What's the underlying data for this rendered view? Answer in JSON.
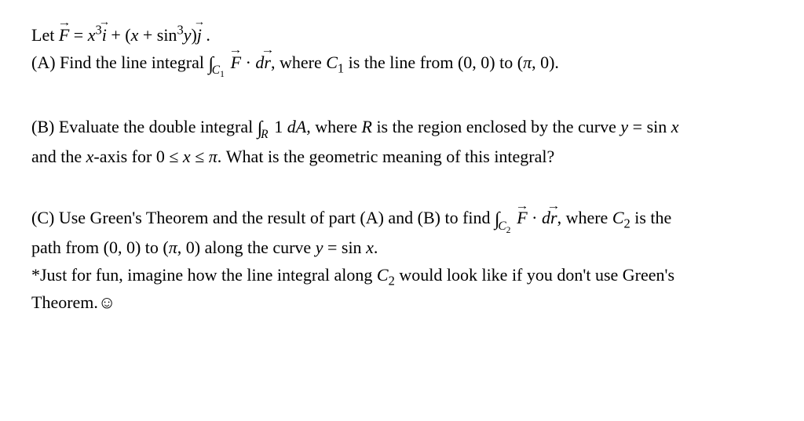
{
  "problem": {
    "intro": {
      "let_prefix": "Let ",
      "vec_F": "F",
      "equals": " = ",
      "x": "x",
      "cube": "3",
      "i_hat": "i",
      "plus1": " + (",
      "plus2": " + sin",
      "y": "y",
      "close": ")",
      "j_hat": "j",
      "period": " ."
    },
    "partA": {
      "label": "(A) Find the line integral ",
      "int_sub": "C",
      "int_sub_num": "1",
      "vec_F": "F",
      "dot": " · ",
      "d": "d",
      "vec_r": "r",
      "after": ", where ",
      "C": "C",
      "sub1": "1",
      "rest": " is the line from (0, 0) to (",
      "pi": "π",
      "end": ", 0)."
    },
    "partB": {
      "line1_pre": "(B) Evaluate the double integral ",
      "int_sub": "R",
      "one": " 1 ",
      "dA": "dA",
      "after": ", where ",
      "R": "R",
      "mid": " is the region enclosed by the curve ",
      "y": "y",
      "eq": " = sin ",
      "x": "x",
      "line2_pre": "and the ",
      "xaxis": "x",
      "line2_mid": "-axis for 0 ≤ ",
      "line2_x": "x",
      "line2_le": " ≤ ",
      "pi": "π",
      "line2_end": ". What is the geometric meaning of this integral?"
    },
    "partC": {
      "line1_pre": "(C) Use Green's Theorem and the result of part (A) and (B) to find ",
      "int_sub": "C",
      "int_sub_num": "2",
      "vec_F": "F",
      "dot": " · ",
      "d": "d",
      "vec_r": "r",
      "after": ", where ",
      "C": "C",
      "sub2": "2",
      "end1": " is the",
      "line2_pre": "path from (0, 0) to (",
      "pi": "π",
      "line2_mid": ", 0) along the curve ",
      "y": "y",
      "eq": " = sin ",
      "x": "x",
      "period": ".",
      "line3_pre": "*Just for fun, imagine how the line integral along ",
      "C3": "C",
      "sub2b": "2",
      "line3_end": " would look like if you don't use Green's",
      "line4": "Theorem.",
      "smiley": "☺"
    }
  }
}
